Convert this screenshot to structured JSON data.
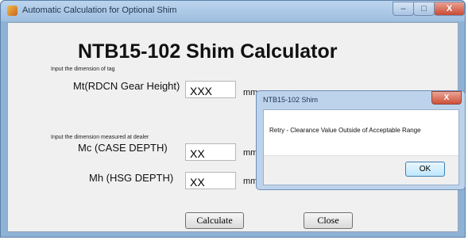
{
  "window": {
    "title": "Automatic Calculation for Optional Shim",
    "minimize_glyph": "–",
    "maximize_glyph": "□",
    "close_glyph": "X"
  },
  "form": {
    "title": "NTB15-102 Shim Calculator",
    "section_tag": "Input the dimension of tag",
    "section_dealer": "Input the dimension measured at dealer",
    "fields": [
      {
        "label": "Mt(RDCN Gear Height)",
        "value": "XXX",
        "unit": "mm"
      },
      {
        "label": "Mc (CASE DEPTH)",
        "value": "XX",
        "unit": "mm"
      },
      {
        "label": "Mh (HSG DEPTH)",
        "value": "XX",
        "unit": "mm"
      }
    ],
    "calculate_label": "Calculate",
    "close_label": "Close"
  },
  "dialog": {
    "title": "NTB15-102 Shim",
    "close_glyph": "X",
    "message": "Retry - Clearance Value Outside of Acceptable Range",
    "ok_label": "OK"
  },
  "colors": {
    "titlebar": "#9fbedf",
    "close_button": "#c94a33",
    "client_background": "#f0f0f0"
  }
}
